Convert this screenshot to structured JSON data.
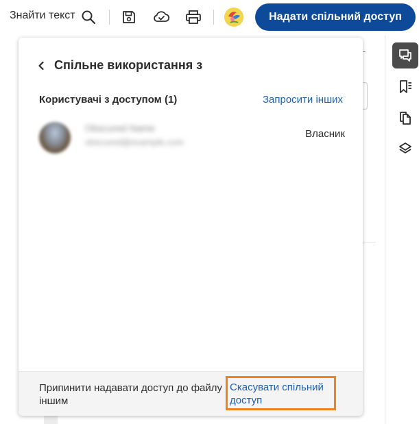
{
  "toolbar": {
    "find_text_label": "Знайти текст",
    "share_button_label": "Надати спільний доступ",
    "icons": [
      "search-icon",
      "save-icon",
      "cloud-sync-icon",
      "print-icon",
      "user-avatar"
    ]
  },
  "right_rail": {
    "icons": [
      "comment-icon",
      "bookmark-list-icon",
      "copy-pages-icon",
      "layers-icon"
    ],
    "active_index": 0
  },
  "share_panel": {
    "title": "Спільне використання з",
    "users_label": "Користувачі з доступом (1)",
    "invite_link": "Запросити інших",
    "users": [
      {
        "name": "Obscured Name",
        "email": "obscured@example.com",
        "role": "Власник"
      }
    ],
    "footer_text": "Припинити надавати доступ до файлу іншим",
    "unshare_link": "Скасувати спільний доступ"
  },
  "colors": {
    "primary_button": "#0d4a99",
    "link": "#1c5fb3",
    "highlight_border": "#f0821e",
    "rail_active": "#4b4b4b"
  }
}
